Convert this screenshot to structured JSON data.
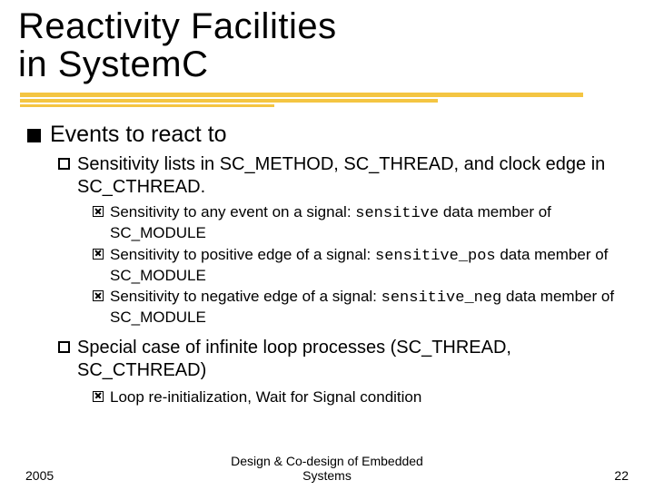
{
  "title_line1": "Reactivity Facilities",
  "title_line2": "in System",
  "title_cchar": "C",
  "l1_1": "Events to react to",
  "l2_1_a": "Sensitivity lists in SC_METHOD, SC_THREAD, and clock edge in SC_CTHREAD.",
  "l3_1_pre": "Sensitivity to any event on a signal: ",
  "l3_1_code": "sensitive",
  "l3_1_post": " data member of SC_MODULE",
  "l3_2_pre": "Sensitivity to positive edge of a signal: ",
  "l3_2_code": "sensitive_pos",
  "l3_2_post": " data member of SC_MODULE",
  "l3_3_pre": "Sensitivity to negative edge of a signal: ",
  "l3_3_code": "sensitive_neg",
  "l3_3_post": " data member of SC_MODULE",
  "l2_2": "Special case of infinite loop processes (SC_THREAD, SC_CTHREAD)",
  "l3_4": "Loop re-initialization, Wait for Signal condition",
  "footer_left": "2005",
  "footer_center_a": "Design & Co-design of Embedded",
  "footer_center_b": "Systems",
  "footer_right": "22"
}
